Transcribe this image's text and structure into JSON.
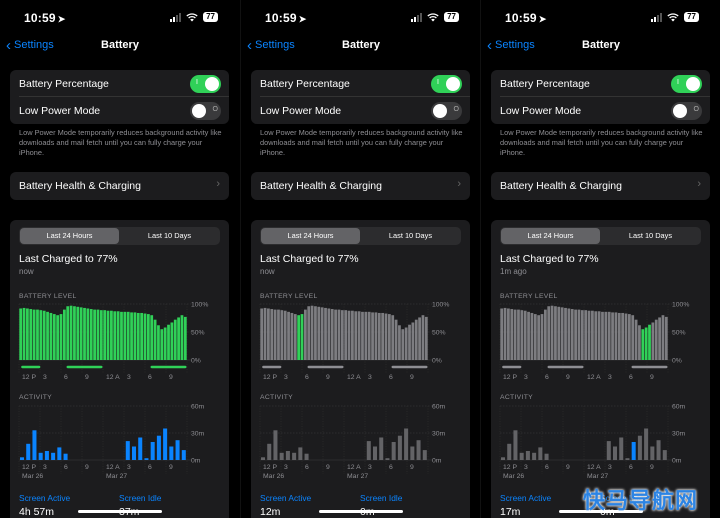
{
  "colors": {
    "accent": "#0a84ff",
    "toggle_on": "#30d158",
    "battery_highlight": "#30d158",
    "battery_dim": "#8e8e93",
    "activity_highlight": "#0a84ff",
    "activity_dim": "#636366"
  },
  "watermark": "快马导航网",
  "screens": [
    {
      "status": {
        "time": "10:59",
        "location_icon": "location-arrow-icon",
        "battery": "77"
      },
      "nav": {
        "back_label": "Settings",
        "title": "Battery"
      },
      "settings": {
        "battery_percentage": {
          "label": "Battery Percentage",
          "on": true
        },
        "low_power_mode": {
          "label": "Low Power Mode",
          "on": false
        },
        "footnote": "Low Power Mode temporarily reduces background activity like downloads and mail fetch until you can fully charge your iPhone.",
        "health_label": "Battery Health & Charging"
      },
      "usage": {
        "tabs": [
          "Last 24 Hours",
          "Last 10 Days"
        ],
        "active_tab": 0,
        "last_charged": "Last Charged to 77%",
        "last_charged_sub": "now",
        "battery_level_title": "BATTERY LEVEL",
        "activity_title": "ACTIVITY",
        "screen_active_label": "Screen Active",
        "screen_active_value": "4h 57m",
        "screen_idle_label": "Screen Idle",
        "screen_idle_value": "37m"
      },
      "highlight": {
        "battery_from": 0,
        "battery_to": 1,
        "activity_bars": "all"
      }
    },
    {
      "status": {
        "time": "10:59",
        "location_icon": "location-arrow-icon",
        "battery": "77"
      },
      "nav": {
        "back_label": "Settings",
        "title": "Battery"
      },
      "settings": {
        "battery_percentage": {
          "label": "Battery Percentage",
          "on": true
        },
        "low_power_mode": {
          "label": "Low Power Mode",
          "on": false
        },
        "footnote": "Low Power Mode temporarily reduces background activity like downloads and mail fetch until you can fully charge your iPhone.",
        "health_label": "Battery Health & Charging"
      },
      "usage": {
        "tabs": [
          "Last 24 Hours",
          "Last 10 Days"
        ],
        "active_tab": 0,
        "last_charged": "Last Charged to 77%",
        "last_charged_sub": "now",
        "battery_level_title": "BATTERY LEVEL",
        "activity_title": "ACTIVITY",
        "screen_active_label": "Screen Active",
        "screen_active_value": "12m",
        "screen_idle_label": "Screen Idle",
        "screen_idle_value": "0m"
      },
      "highlight": {
        "battery_from": 0.22,
        "battery_to": 0.26,
        "activity_bars": []
      }
    },
    {
      "status": {
        "time": "10:59",
        "location_icon": "location-arrow-icon",
        "battery": "77"
      },
      "nav": {
        "back_label": "Settings",
        "title": "Battery"
      },
      "settings": {
        "battery_percentage": {
          "label": "Battery Percentage",
          "on": true
        },
        "low_power_mode": {
          "label": "Low Power Mode",
          "on": false
        },
        "footnote": "Low Power Mode temporarily reduces background activity like downloads and mail fetch until you can fully charge your iPhone.",
        "health_label": "Battery Health & Charging"
      },
      "usage": {
        "tabs": [
          "Last 24 Hours",
          "Last 10 Days"
        ],
        "active_tab": 0,
        "last_charged": "Last Charged to 77%",
        "last_charged_sub": "1m ago",
        "battery_level_title": "BATTERY LEVEL",
        "activity_title": "ACTIVITY",
        "screen_active_label": "Screen Active",
        "screen_active_value": "17m",
        "screen_idle_label": "Screen Idle",
        "screen_idle_value": "0m"
      },
      "highlight": {
        "battery_from": 0.84,
        "battery_to": 0.89,
        "activity_bars": [
          21
        ]
      }
    }
  ],
  "chart_data": [
    {
      "type": "area",
      "title": "BATTERY LEVEL",
      "ylim": [
        0,
        100
      ],
      "y_ticks": [
        "100%",
        "50%",
        "0%"
      ],
      "x_ticks": [
        "12 P",
        "3",
        "6",
        "9",
        "12 A",
        "3",
        "6",
        "9"
      ],
      "x_dates": [
        "Mar 26",
        "Mar 27"
      ],
      "values": [
        92,
        93,
        92,
        91,
        90,
        90,
        89,
        88,
        86,
        84,
        82,
        80,
        82,
        90,
        96,
        97,
        96,
        95,
        94,
        93,
        92,
        91,
        90,
        90,
        89,
        89,
        88,
        88,
        87,
        87,
        86,
        86,
        86,
        85,
        85,
        84,
        84,
        83,
        82,
        80,
        72,
        62,
        55,
        58,
        63,
        67,
        72,
        76,
        80,
        77
      ],
      "charging_segments": [
        [
          0.02,
          0.12
        ],
        [
          0.29,
          0.49
        ],
        [
          0.79,
          0.99
        ]
      ]
    },
    {
      "type": "bar",
      "title": "ACTIVITY",
      "ylim": [
        0,
        60
      ],
      "y_ticks": [
        "60m",
        "30m",
        "0m"
      ],
      "x_ticks": [
        "12 P",
        "3",
        "6",
        "9",
        "12 A",
        "3",
        "6",
        "9"
      ],
      "x_dates": [
        "Mar 26",
        "Mar 27"
      ],
      "values": [
        3,
        18,
        33,
        8,
        10,
        8,
        14,
        7,
        0,
        0,
        0,
        0,
        0,
        0,
        0,
        0,
        0,
        21,
        15,
        25,
        2,
        20,
        27,
        35,
        15,
        22,
        11
      ]
    }
  ]
}
